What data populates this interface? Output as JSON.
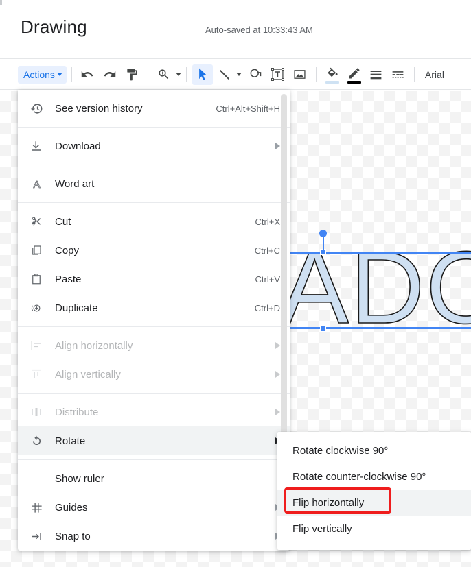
{
  "header": {
    "title": "Drawing",
    "autosave": "Auto-saved at 10:33:43 AM"
  },
  "toolbar": {
    "actions_label": "Actions",
    "font_name": "Arial",
    "items": [
      {
        "name": "undo-icon",
        "tooltip": "Undo"
      },
      {
        "name": "redo-icon",
        "tooltip": "Redo"
      },
      {
        "name": "paint-format-icon",
        "tooltip": "Paint format"
      },
      {
        "name": "zoom-icon",
        "tooltip": "Zoom"
      },
      {
        "name": "select-cursor-icon",
        "tooltip": "Select",
        "active": true
      },
      {
        "name": "line-icon",
        "tooltip": "Line"
      },
      {
        "name": "shape-icon",
        "tooltip": "Shape"
      },
      {
        "name": "text-box-icon",
        "tooltip": "Text box"
      },
      {
        "name": "image-icon",
        "tooltip": "Image"
      },
      {
        "name": "fill-color-icon",
        "tooltip": "Fill color"
      },
      {
        "name": "line-color-icon",
        "tooltip": "Line color"
      },
      {
        "name": "line-weight-icon",
        "tooltip": "Line weight"
      },
      {
        "name": "line-dash-icon",
        "tooltip": "Line dash"
      }
    ]
  },
  "colors": {
    "accent_blue": "#1a73e8",
    "actions_bg": "#e8f0fe",
    "selection_blue": "#4285f4",
    "annotation_red": "#ef1d1d",
    "highlight_gray": "#f1f3f4",
    "fill_swatch": "#cfe2f3",
    "line_swatch": "#000000"
  },
  "menu": {
    "items": [
      {
        "label": "See version history",
        "accel": "Ctrl+Alt+Shift+H",
        "icon": "history-icon",
        "arrow": false,
        "disabled": false
      },
      {
        "label": "Download",
        "accel": "",
        "icon": "download-icon",
        "arrow": true,
        "disabled": false
      },
      {
        "label": "Word art",
        "accel": "",
        "icon": "word-art-icon",
        "arrow": false,
        "disabled": false
      },
      {
        "label": "Cut",
        "accel": "Ctrl+X",
        "icon": "scissors-icon",
        "arrow": false,
        "disabled": false
      },
      {
        "label": "Copy",
        "accel": "Ctrl+C",
        "icon": "copy-icon",
        "arrow": false,
        "disabled": false
      },
      {
        "label": "Paste",
        "accel": "Ctrl+V",
        "icon": "clipboard-icon",
        "arrow": false,
        "disabled": false
      },
      {
        "label": "Duplicate",
        "accel": "Ctrl+D",
        "icon": "duplicate-icon",
        "arrow": false,
        "disabled": false
      },
      {
        "label": "Align horizontally",
        "accel": "",
        "icon": "align-horizontal-icon",
        "arrow": true,
        "disabled": true
      },
      {
        "label": "Align vertically",
        "accel": "",
        "icon": "align-vertical-icon",
        "arrow": true,
        "disabled": true
      },
      {
        "label": "Distribute",
        "accel": "",
        "icon": "distribute-icon",
        "arrow": true,
        "disabled": true
      },
      {
        "label": "Rotate",
        "accel": "",
        "icon": "rotate-icon",
        "arrow": true,
        "disabled": false,
        "highlighted": true
      },
      {
        "label": "Show ruler",
        "accel": "",
        "icon": "",
        "arrow": false,
        "disabled": false
      },
      {
        "label": "Guides",
        "accel": "",
        "icon": "guides-icon",
        "arrow": true,
        "disabled": false
      },
      {
        "label": "Snap to",
        "accel": "",
        "icon": "snap-to-icon",
        "arrow": true,
        "disabled": false
      }
    ]
  },
  "submenu": {
    "items": [
      {
        "label": "Rotate clockwise 90°",
        "highlighted": false
      },
      {
        "label": "Rotate counter-clockwise 90°",
        "highlighted": false
      },
      {
        "label": "Flip horizontally",
        "highlighted": true,
        "annotated": true
      },
      {
        "label": "Flip vertically",
        "highlighted": false
      }
    ]
  },
  "canvas": {
    "word_art_text": "ADO",
    "background": "transparent-checkerboard"
  }
}
